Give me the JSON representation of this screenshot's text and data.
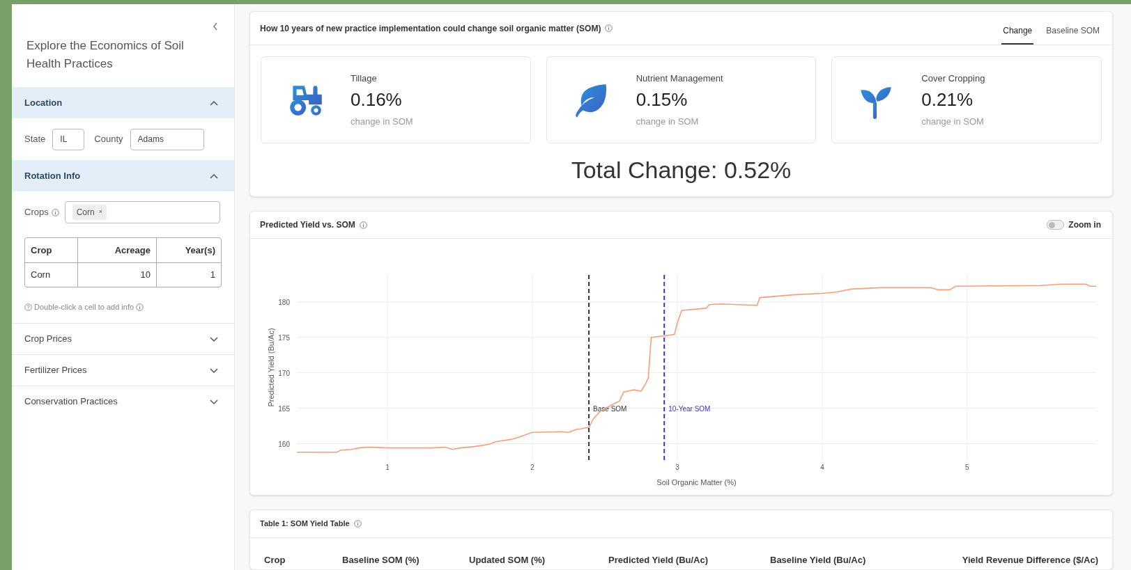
{
  "sidebar": {
    "title": "Explore the Economics of Soil Health Practices",
    "sections": [
      {
        "kind": "location",
        "title": "Location",
        "expanded": true,
        "fields": [
          {
            "label": "State",
            "value": "IL"
          },
          {
            "label": "County",
            "value": "Adams"
          }
        ]
      },
      {
        "kind": "rotation",
        "title": "Rotation Info",
        "expanded": true,
        "crops_label": "Crops",
        "chips": [
          {
            "label": "Corn",
            "remove": "×"
          }
        ],
        "table": {
          "columns": [
            "Crop",
            "Acreage",
            "Year(s)"
          ],
          "rows": [
            [
              "Corn",
              "10",
              "1"
            ]
          ]
        },
        "hint": "Double-click a cell to add info"
      },
      {
        "kind": "plain",
        "title": "Crop Prices",
        "expanded": false
      },
      {
        "kind": "plain",
        "title": "Fertilizer Prices",
        "expanded": false
      },
      {
        "kind": "plain",
        "title": "Conservation Practices",
        "expanded": false
      }
    ]
  },
  "som_card": {
    "title": "How 10 years of new practice implementation could change soil organic matter (SOM)",
    "tabs": [
      {
        "label": "Change",
        "selected": true
      },
      {
        "label": "Baseline SOM",
        "selected": false
      }
    ],
    "practices": [
      {
        "kind": "tillage",
        "name": "Tillage",
        "value": "0.16%",
        "caption": "change in SOM"
      },
      {
        "kind": "nutrient",
        "name": "Nutrient Management",
        "value": "0.15%",
        "caption": "change in SOM"
      },
      {
        "kind": "cover",
        "name": "Cover Cropping",
        "value": "0.21%",
        "caption": "change in SOM"
      }
    ],
    "total": "Total Change: 0.52%"
  },
  "yield_chart": {
    "title": "Predicted Yield vs. SOM",
    "zoom_toggle": {
      "label": "Zoom in",
      "on": false
    },
    "chart_data": {
      "type": "line",
      "xlabel": "Soil Organic Matter (%)",
      "ylabel": "Predicted Yield (Bu/Ac)",
      "x": [
        0.375,
        0.65,
        0.68,
        0.75,
        0.8,
        0.85,
        0.9,
        1.0,
        1.3,
        1.4,
        1.45,
        1.5,
        1.6,
        1.7,
        1.75,
        1.85,
        1.9,
        2.0,
        2.2,
        2.25,
        2.3,
        2.39,
        2.42,
        2.47,
        2.55,
        2.6,
        2.63,
        2.7,
        2.75,
        2.78,
        2.8,
        2.82,
        2.9,
        2.98,
        3.0,
        3.03,
        3.2,
        3.22,
        3.3,
        3.55,
        3.57,
        3.8,
        4.0,
        4.1,
        4.2,
        4.4,
        4.75,
        4.8,
        4.88,
        4.92,
        5.5,
        5.65,
        5.82,
        5.85,
        5.89
      ],
      "series": [
        {
          "color": "#f2a07b",
          "values": [
            158.8,
            158.8,
            159.1,
            159.2,
            159.4,
            159.5,
            159.5,
            159.4,
            159.4,
            159.5,
            159.2,
            159.4,
            159.6,
            159.9,
            160.3,
            160.6,
            160.9,
            161.6,
            161.7,
            161.6,
            162.0,
            162.3,
            163.5,
            164.6,
            165.5,
            166.0,
            167.3,
            167.6,
            167.4,
            168.4,
            169.3,
            175.0,
            175.2,
            175.4,
            177.0,
            178.8,
            179.1,
            179.6,
            179.7,
            179.5,
            180.6,
            181.0,
            181.2,
            181.4,
            181.8,
            182.0,
            182.0,
            181.7,
            181.7,
            182.2,
            182.3,
            182.5,
            182.5,
            182.2,
            182.2
          ]
        }
      ],
      "xlim": [
        0.375,
        5.89
      ],
      "ylim": [
        157.5,
        184
      ],
      "xticks": [
        1,
        2,
        3,
        4,
        5
      ],
      "yticks": [
        160,
        165,
        170,
        175,
        180
      ],
      "grid": true,
      "ref_lines": [
        {
          "axis": "x",
          "value": 2.39,
          "label": "Base SOM",
          "color": "#333333"
        },
        {
          "axis": "x",
          "value": 2.91,
          "label": "10-Year SOM",
          "color": "#3a35b5"
        }
      ]
    }
  },
  "som_table": {
    "title": "Table 1: SOM Yield Table",
    "columns": [
      "Crop",
      "Baseline SOM (%)",
      "Updated SOM (%)",
      "Predicted Yield (Bu/Ac)",
      "Baseline Yield (Bu/Ac)",
      "Yield Revenue Difference ($/Ac)"
    ]
  }
}
